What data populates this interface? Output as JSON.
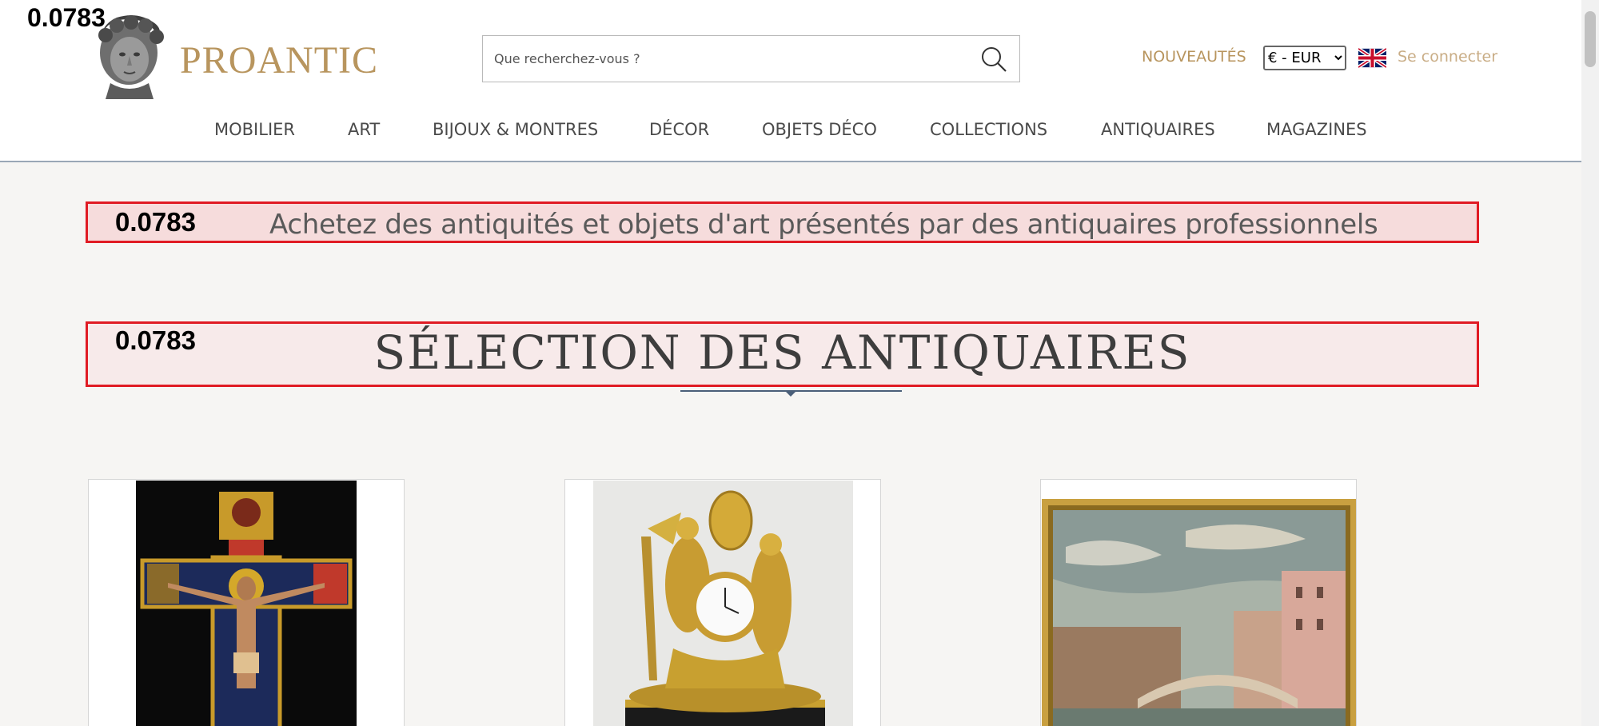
{
  "overlay": {
    "score": "0.0783"
  },
  "header": {
    "brand": "PROANTIC",
    "search": {
      "placeholder": "Que recherchez-vous ?",
      "icon": "search-icon"
    },
    "nouveautes": "NOUVEAUTÉS",
    "currency": {
      "selected": "€ - EUR"
    },
    "flag": "uk-flag-icon",
    "login": "Se connecter"
  },
  "nav": {
    "items": [
      {
        "label": "MOBILIER"
      },
      {
        "label": "ART"
      },
      {
        "label": "BIJOUX & MONTRES"
      },
      {
        "label": "DÉCOR"
      },
      {
        "label": "OBJETS DÉCO"
      },
      {
        "label": "COLLECTIONS"
      },
      {
        "label": "ANTIQUAIRES"
      },
      {
        "label": "MAGAZINES"
      }
    ]
  },
  "banner": {
    "score": "0.0783",
    "tagline": "Achetez des antiquités et objets d'art présentés par des antiquaires professionnels"
  },
  "section": {
    "score": "0.0783",
    "title": "SÉLECTION DES ANTIQUAIRES"
  },
  "products": [
    {
      "image": "crucifix-icon-painting"
    },
    {
      "image": "gilt-bronze-clock"
    },
    {
      "image": "venice-rialto-painting"
    }
  ],
  "colors": {
    "brand_gold": "#b8955e",
    "login_gold": "#c9ad86",
    "highlight_border": "#e01b24",
    "background": "#f6f5f3"
  }
}
